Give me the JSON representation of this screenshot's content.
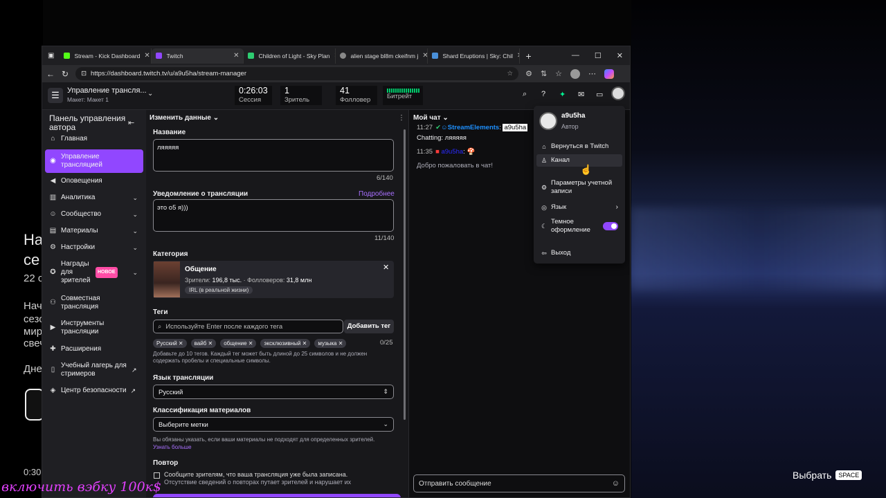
{
  "background": {
    "left_texts": [
      "На",
      "се",
      "22 с",
      "Нач",
      "сезо",
      "мир",
      "свеч",
      "Дне"
    ],
    "time": "0:30",
    "overlay_caption": "включить вэбку 100к$",
    "choose_label": "Выбрать",
    "choose_key": "SPACE"
  },
  "browser": {
    "tabs": [
      {
        "label": "Stream - Kick Dashboard",
        "color": "#53fc18"
      },
      {
        "label": "Twitch",
        "color": "#9147ff"
      },
      {
        "label": "Children of Light - Sky Plan",
        "color": "#2ecc71"
      },
      {
        "label": "alien stage bl8m ckeifnm j",
        "color": "#888888"
      },
      {
        "label": "Shard Eruptions | Sky: Chil",
        "color": "#4a90d9"
      }
    ],
    "url": "https://dashboard.twitch.tv/u/a9u5ha/stream-manager"
  },
  "topnav": {
    "title": "Управление трансля...",
    "subtitle": "Макет: Макет 1",
    "stats": [
      {
        "value": "0:26:03",
        "label": "Сессия"
      },
      {
        "value": "1",
        "label": "Зритель"
      },
      {
        "value": "41",
        "label": "Фолловер"
      },
      {
        "value": "",
        "label": "Битрейт"
      }
    ]
  },
  "sidebar": {
    "header": "Панель управления автора",
    "items": [
      {
        "label": "Главная",
        "icon": "home-icon"
      },
      {
        "label": "Управление трансляцией",
        "icon": "broadcast-icon",
        "active": true
      },
      {
        "label": "Оповещения",
        "icon": "megaphone-icon"
      },
      {
        "label": "Аналитика",
        "icon": "chart-icon",
        "chevron": true
      },
      {
        "label": "Сообщество",
        "icon": "community-icon",
        "chevron": true
      },
      {
        "label": "Материалы",
        "icon": "content-icon",
        "chevron": true
      },
      {
        "label": "Настройки",
        "icon": "gear-icon",
        "chevron": true
      },
      {
        "label": "Награды для зрителей",
        "icon": "gift-icon",
        "chevron": true,
        "badge": "НОВОЕ"
      },
      {
        "label": "Совместная трансляция",
        "icon": "collab-icon"
      },
      {
        "label": "Инструменты трансляции",
        "icon": "camera-icon"
      },
      {
        "label": "Расширения",
        "icon": "extension-icon"
      },
      {
        "label": "Учебный лагерь для стримеров",
        "icon": "book-icon",
        "external": true
      },
      {
        "label": "Центр безопасности",
        "icon": "shield-icon",
        "external": true
      }
    ]
  },
  "edit": {
    "header": "Изменить данные",
    "title_label": "Название",
    "title_value": "ляяяяя",
    "title_count": "6/140",
    "notif_label": "Уведомление о трансляции",
    "notif_more": "Подробнее",
    "notif_value": "это о5 я)))",
    "notif_count": "11/140",
    "category_label": "Категория",
    "category": {
      "name": "Общение",
      "viewers_label": "Зрители:",
      "viewers": "196,8 тыс.",
      "followers_label": "Фолловеров:",
      "followers": "31,8 млн",
      "tag": "IRL (в реальной жизни)"
    },
    "tags_label": "Теги",
    "tags_placeholder": "Используйте Enter после каждого тега",
    "add_tag": "Добавить тег",
    "tags": [
      "Русский",
      "вайб",
      "общение",
      "эксклюзивный",
      "музыка"
    ],
    "tags_count": "0/25",
    "tags_hint": "Добавьте до 10 тегов. Каждый тег может быть длиной до 25 символов и не должен содержать пробелы и специальные символы.",
    "lang_label": "Язык трансляции",
    "lang_value": "Русский",
    "class_label": "Классификация материалов",
    "class_value": "Выберите метки",
    "class_hint": "Вы обязаны указать, если ваши материалы не подходят для определенных зрителей.",
    "class_link": "Узнать больше",
    "repeat_label": "Повтор",
    "repeat_text": "Сообщите зрителям, что ваша трансляция уже была записана.",
    "repeat_text2": "Отсутствие сведений о повторах путает зрителей и нарушает их"
  },
  "chat": {
    "header": "Мой чат",
    "msg1_time": "11:27",
    "msg1_user": "StreamElements",
    "msg1_mention": "a9u5ha",
    "msg1_text": "Chatting: ляяяяя",
    "msg2_time": "11:35",
    "msg2_user": "a9u5ha",
    "welcome": "Добро пожаловать в чат!",
    "input_placeholder": "Отправить сообщение"
  },
  "menu": {
    "username": "a9u5ha",
    "role": "Автор",
    "items": [
      {
        "label": "Вернуться в Twitch",
        "icon": "home-icon"
      },
      {
        "label": "Канал",
        "icon": "user-icon"
      },
      {
        "label": "Параметры учетной записи",
        "icon": "gear-icon"
      },
      {
        "label": "Язык",
        "icon": "globe-icon"
      },
      {
        "label": "Темное оформление",
        "icon": "moon-icon"
      },
      {
        "label": "Выход",
        "icon": "logout-icon"
      }
    ]
  }
}
